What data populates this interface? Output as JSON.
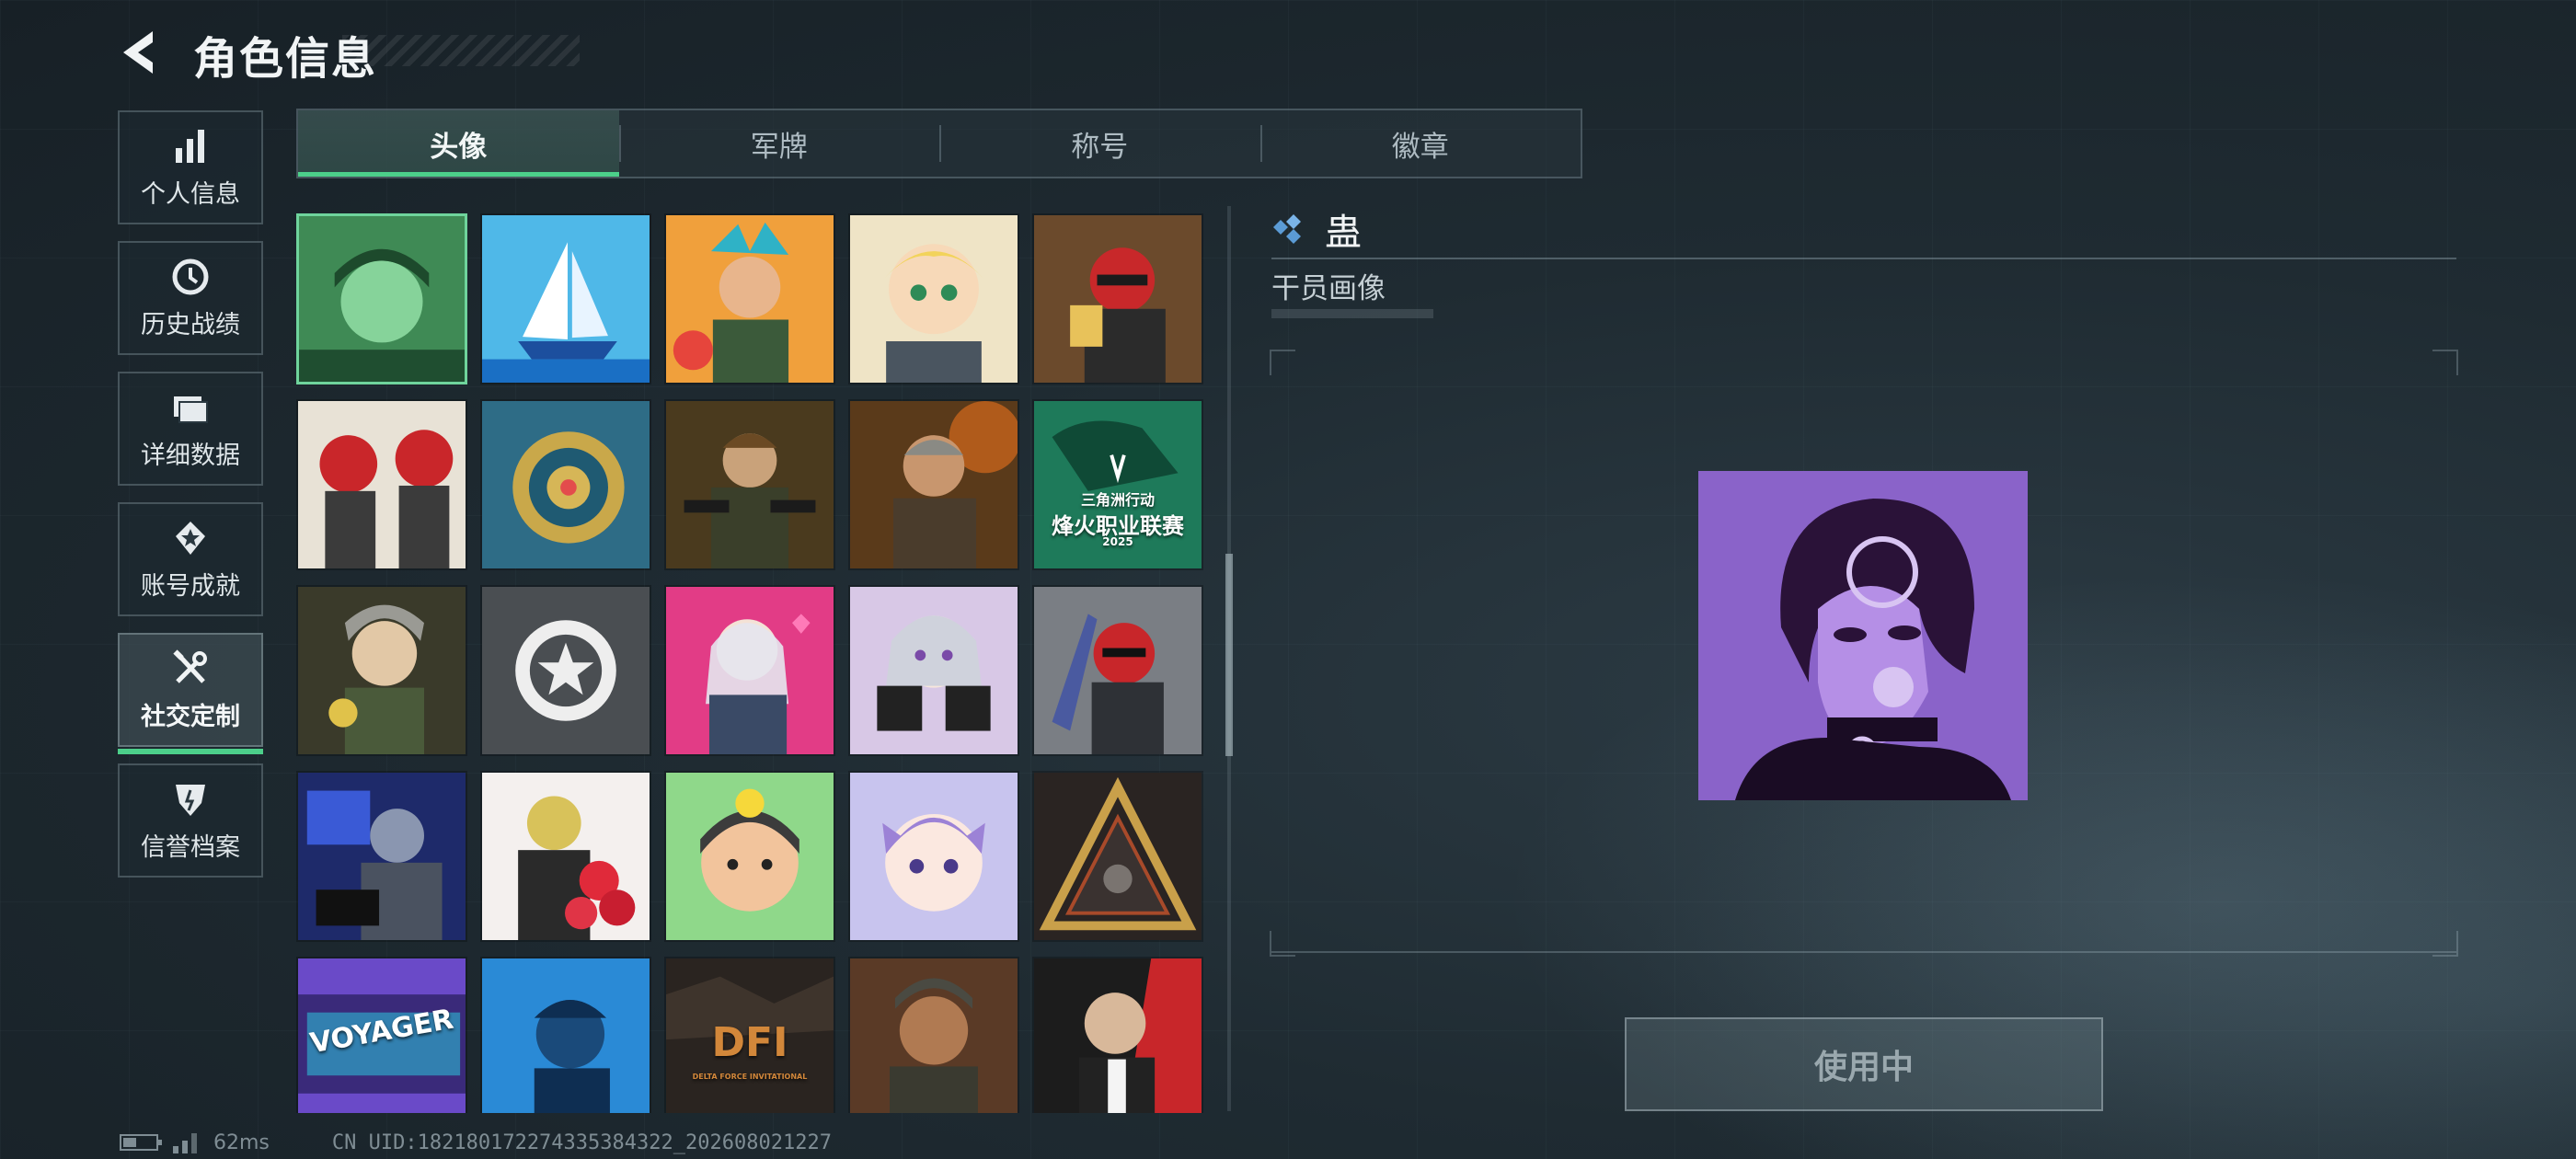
{
  "header": {
    "title": "角色信息"
  },
  "sidebar": {
    "items": [
      {
        "label": "个人信息",
        "icon": "bar-chart-icon"
      },
      {
        "label": "历史战绩",
        "icon": "history-icon"
      },
      {
        "label": "详细数据",
        "icon": "folder-icon"
      },
      {
        "label": "账号成就",
        "icon": "medal-icon"
      },
      {
        "label": "社交定制",
        "icon": "tools-icon",
        "active": true
      },
      {
        "label": "信誉档案",
        "icon": "shield-icon"
      }
    ]
  },
  "tabs": [
    {
      "label": "头像",
      "active": true
    },
    {
      "label": "军牌"
    },
    {
      "label": "称号"
    },
    {
      "label": "徽章"
    }
  ],
  "avatars": {
    "tile_texts": [
      "三角洲行动",
      "烽火职业联赛",
      "2025",
      "VOYAGER",
      "DFI",
      "DELTA FORCE INVITATIONAL"
    ]
  },
  "detail": {
    "name": "蛊",
    "category": "干员画像",
    "button_label": "使用中"
  },
  "status": {
    "ping": "62ms",
    "uid": "CN UID:182180172274335384322_202608021227"
  },
  "colors": {
    "accent": "#4ccf8a",
    "preview_purple": "#8a63c9",
    "diamond": "#5b9bd5"
  }
}
